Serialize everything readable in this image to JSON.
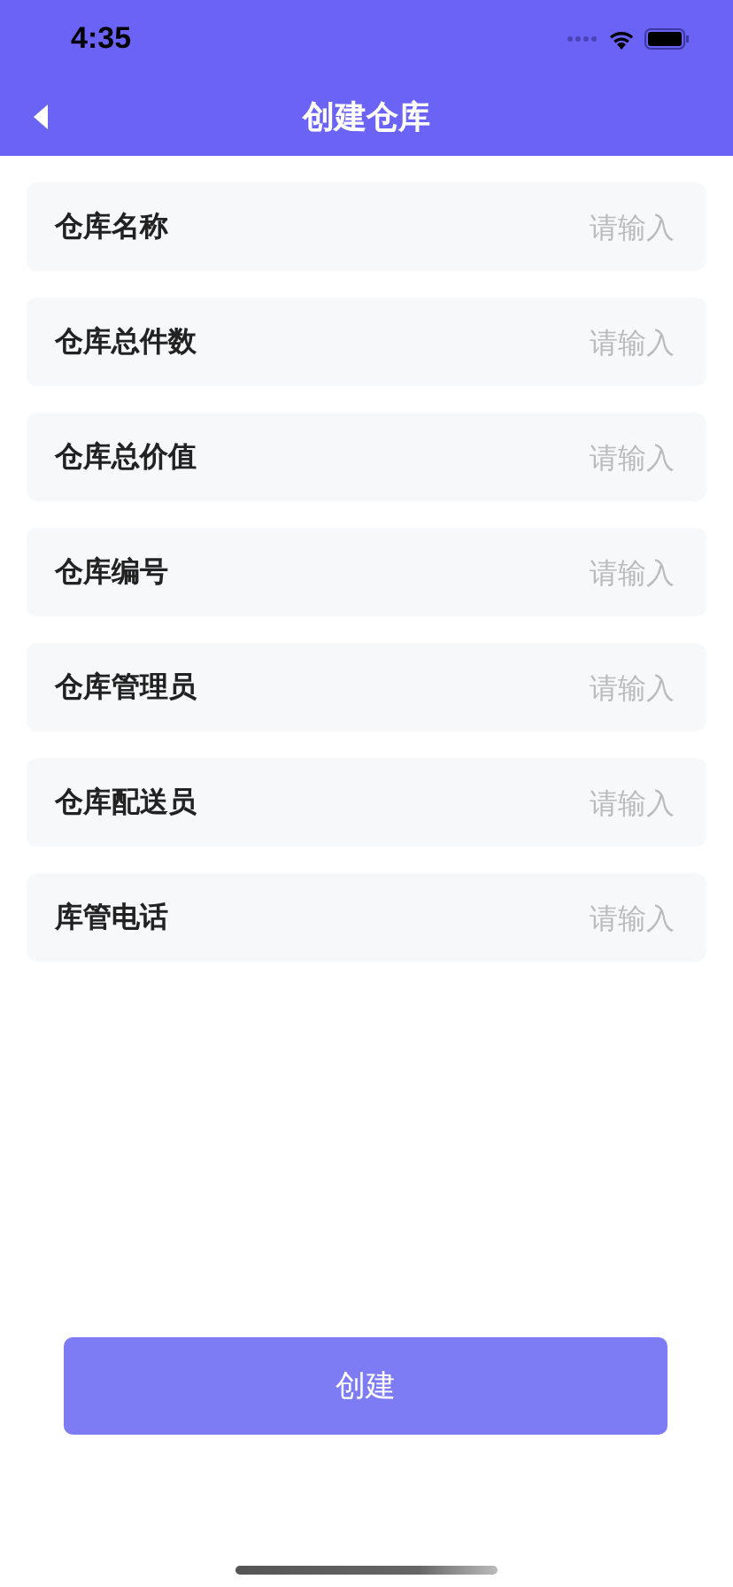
{
  "status_bar": {
    "time": "4:35"
  },
  "nav": {
    "title": "创建仓库"
  },
  "fields": [
    {
      "label": "仓库名称",
      "placeholder": "请输入"
    },
    {
      "label": "仓库总件数",
      "placeholder": "请输入"
    },
    {
      "label": "仓库总价值",
      "placeholder": "请输入"
    },
    {
      "label": "仓库编号",
      "placeholder": "请输入"
    },
    {
      "label": "仓库管理员",
      "placeholder": "请输入"
    },
    {
      "label": "仓库配送员",
      "placeholder": "请输入"
    },
    {
      "label": "库管电话",
      "placeholder": "请输入"
    }
  ],
  "submit_button": {
    "label": "创建"
  }
}
